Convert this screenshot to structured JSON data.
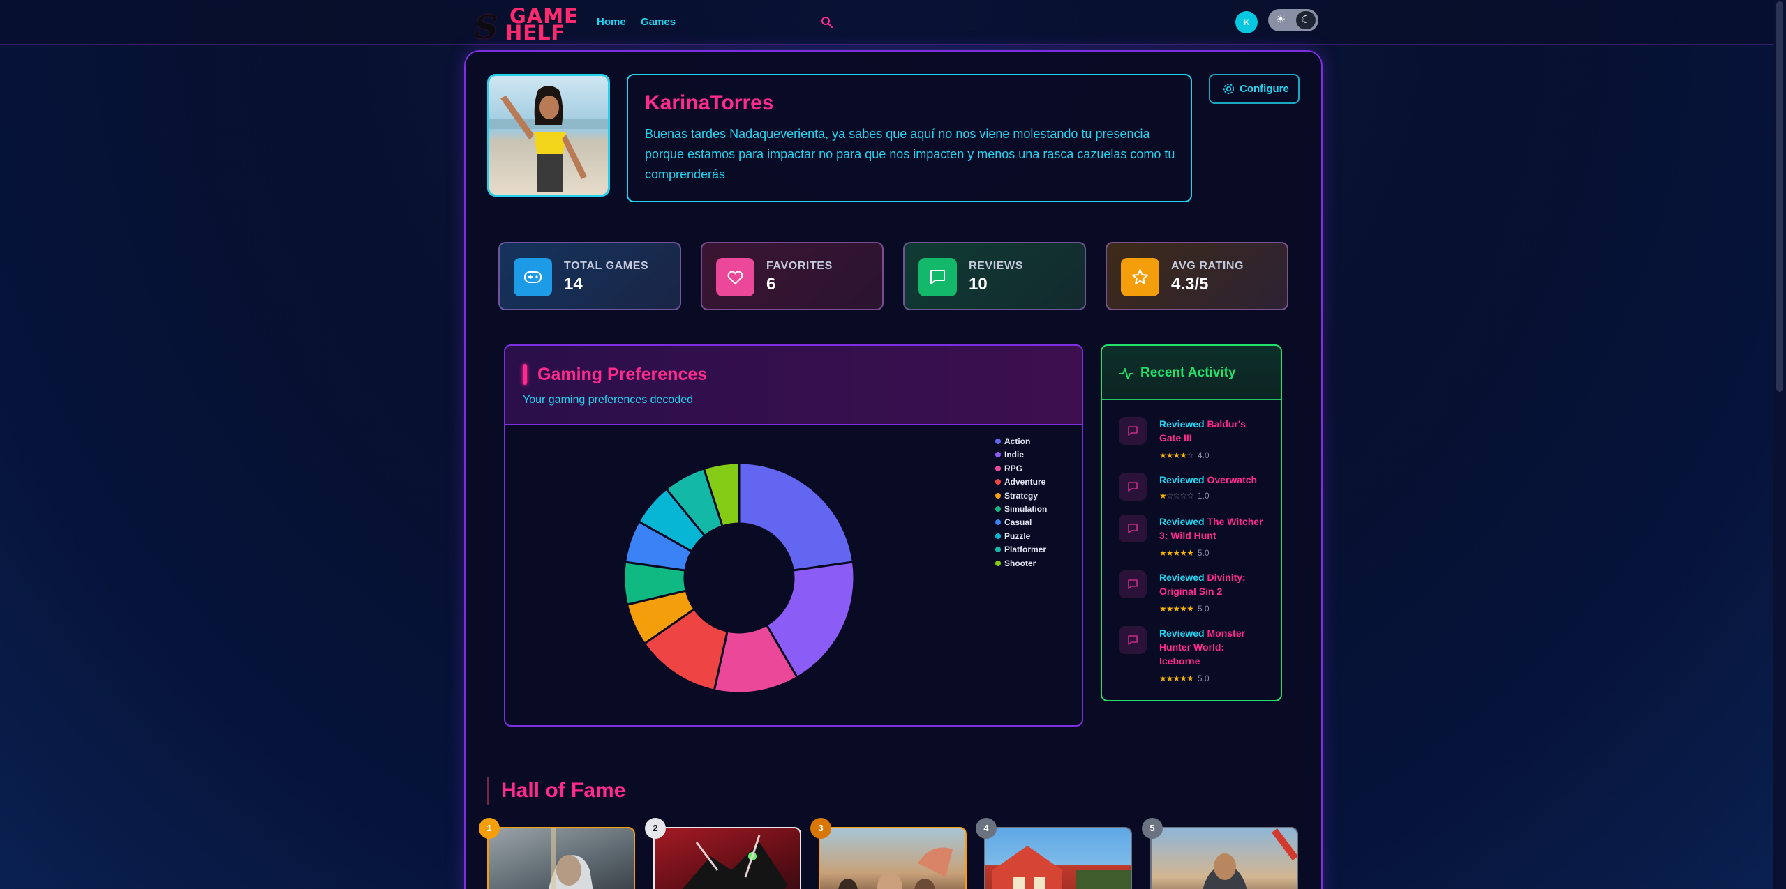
{
  "nav": {
    "logo_line1": "GAME",
    "logo_line2": "HELF",
    "links": [
      "Home",
      "Games"
    ],
    "avatar_initial": "K"
  },
  "profile": {
    "username": "KarinaTorres",
    "bio": "Buenas tardes Nadaqueverienta, ya sabes que aquí no nos viene molestando tu presencia porque estamos para impactar no para que nos impacten y menos una rasca cazuelas como tu comprenderás",
    "configure_label": "Configure"
  },
  "stats": [
    {
      "label": "TOTAL GAMES",
      "value": "14",
      "icon": "gamepad-icon",
      "color": "#1e9be6"
    },
    {
      "label": "FAVORITES",
      "value": "6",
      "icon": "heart-icon",
      "color": "#ec4899"
    },
    {
      "label": "REVIEWS",
      "value": "10",
      "icon": "message-icon",
      "color": "#14b86a"
    },
    {
      "label": "AVG RATING",
      "value": "4.3/5",
      "icon": "star-icon",
      "color": "#f59e0b"
    }
  ],
  "preferences": {
    "title": "Gaming Preferences",
    "subtitle": "Your gaming preferences decoded"
  },
  "chart_data": {
    "type": "pie",
    "donut": true,
    "categories": [
      "Action",
      "Indie",
      "RPG",
      "Adventure",
      "Strategy",
      "Simulation",
      "Casual",
      "Puzzle",
      "Platformer",
      "Shooter"
    ],
    "values": [
      23,
      19,
      12,
      12,
      6,
      6,
      6,
      6,
      6,
      5
    ],
    "colors": [
      "#6366f1",
      "#8b5cf6",
      "#ec4899",
      "#ef4444",
      "#f59e0b",
      "#10b981",
      "#3b82f6",
      "#06b6d4",
      "#14b8a6",
      "#84cc16"
    ],
    "legend_position": "top-right"
  },
  "activity": {
    "title": "Recent Activity",
    "items": [
      {
        "prefix": "Reviewed",
        "game": "Baldur's Gate III",
        "rating": 4,
        "rating_text": "4.0"
      },
      {
        "prefix": "Reviewed",
        "game": "Overwatch",
        "rating": 1,
        "rating_text": "1.0"
      },
      {
        "prefix": "Reviewed",
        "game": "The Witcher 3: Wild Hunt",
        "rating": 5,
        "rating_text": "5.0"
      },
      {
        "prefix": "Reviewed",
        "game": "Divinity: Original Sin 2",
        "rating": 5,
        "rating_text": "5.0"
      },
      {
        "prefix": "Reviewed",
        "game": "Monster Hunter World: Iceborne",
        "rating": 5,
        "rating_text": "5.0"
      }
    ]
  },
  "hall_of_fame": {
    "title": "Hall of Fame",
    "ranks": [
      "1",
      "2",
      "3",
      "4",
      "5"
    ],
    "rank_colors": [
      "#f59e0b",
      "#e5e7eb",
      "#d97706",
      "#6b7280",
      "#6b7280"
    ]
  }
}
